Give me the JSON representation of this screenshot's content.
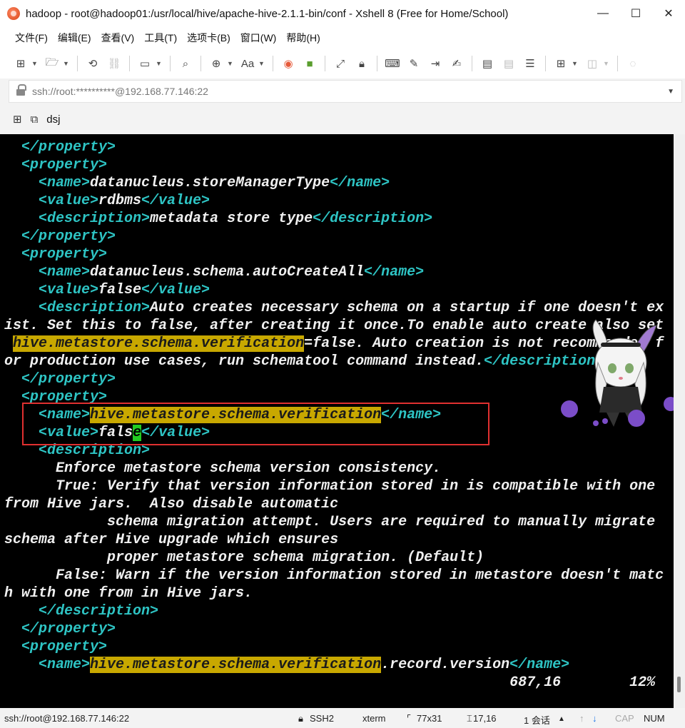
{
  "window": {
    "title": "hadoop - root@hadoop01:/usr/local/hive/apache-hive-2.1.1-bin/conf - Xshell 8 (Free for Home/School)",
    "minimize": "—",
    "maximize": "☐",
    "close": "✕"
  },
  "menu": [
    "文件(F)",
    "编辑(E)",
    "查看(V)",
    "工具(T)",
    "选项卡(B)",
    "窗口(W)",
    "帮助(H)"
  ],
  "address": {
    "text": "ssh://root:**********@192.168.77.146:22",
    "dropdown_icon": "chevron-down-icon"
  },
  "tab": {
    "label": "dsj"
  },
  "terminal": {
    "lines": [
      [
        {
          "t": "  "
        },
        {
          "t": "</property>",
          "c": "tag"
        }
      ],
      [
        {
          "t": "  "
        },
        {
          "t": "<property>",
          "c": "tag"
        }
      ],
      [
        {
          "t": "    "
        },
        {
          "t": "<name>",
          "c": "tag"
        },
        {
          "t": "datanucleus.storeManagerType"
        },
        {
          "t": "</name>",
          "c": "tag"
        }
      ],
      [
        {
          "t": "    "
        },
        {
          "t": "<value>",
          "c": "tag"
        },
        {
          "t": "rdbms"
        },
        {
          "t": "</value>",
          "c": "tag"
        }
      ],
      [
        {
          "t": "    "
        },
        {
          "t": "<description>",
          "c": "tag"
        },
        {
          "t": "metadata store type"
        },
        {
          "t": "</description>",
          "c": "tag"
        }
      ],
      [
        {
          "t": "  "
        },
        {
          "t": "</property>",
          "c": "tag"
        }
      ],
      [
        {
          "t": "  "
        },
        {
          "t": "<property>",
          "c": "tag"
        }
      ],
      [
        {
          "t": "    "
        },
        {
          "t": "<name>",
          "c": "tag"
        },
        {
          "t": "datanucleus.schema.autoCreateAll"
        },
        {
          "t": "</name>",
          "c": "tag"
        }
      ],
      [
        {
          "t": "    "
        },
        {
          "t": "<value>",
          "c": "tag"
        },
        {
          "t": "false"
        },
        {
          "t": "</value>",
          "c": "tag"
        }
      ],
      [
        {
          "t": "    "
        },
        {
          "t": "<description>",
          "c": "tag"
        },
        {
          "t": "Auto creates necessary schema on a startup if one doesn't ex"
        }
      ],
      [
        {
          "t": "ist. Set this to false, after creating it once.To enable auto create also set"
        }
      ],
      [
        {
          "t": " "
        },
        {
          "t": "hive.metastore.schema.verification",
          "c": "hl"
        },
        {
          "t": "=false. Auto creation is not recommended f"
        }
      ],
      [
        {
          "t": "or production use cases, run schematool command instead."
        },
        {
          "t": "</description>",
          "c": "tag"
        }
      ],
      [
        {
          "t": "  "
        },
        {
          "t": "</property>",
          "c": "tag"
        }
      ],
      [
        {
          "t": "  "
        },
        {
          "t": "<property>",
          "c": "tag"
        }
      ],
      [
        {
          "t": "    "
        },
        {
          "t": "<name>",
          "c": "tag"
        },
        {
          "t": "hive.metastore.schema.verification",
          "c": "hl"
        },
        {
          "t": "</name>",
          "c": "tag"
        }
      ],
      [
        {
          "t": "    "
        },
        {
          "t": "<value>",
          "c": "tag"
        },
        {
          "t": "fals"
        },
        {
          "t": "e",
          "c": "cursor"
        },
        {
          "t": "</value>",
          "c": "tag"
        }
      ],
      [
        {
          "t": "    "
        },
        {
          "t": "<description>",
          "c": "tag"
        }
      ],
      [
        {
          "t": "      Enforce metastore schema version consistency."
        }
      ],
      [
        {
          "t": "      True: Verify that version information stored in is compatible with one"
        }
      ],
      [
        {
          "t": "from Hive jars.  Also disable automatic"
        }
      ],
      [
        {
          "t": "            schema migration attempt. Users are required to manually migrate"
        }
      ],
      [
        {
          "t": "schema after Hive upgrade which ensures"
        }
      ],
      [
        {
          "t": "            proper metastore schema migration. (Default)"
        }
      ],
      [
        {
          "t": "      False: Warn if the version information stored in metastore doesn't matc"
        }
      ],
      [
        {
          "t": "h with one from in Hive jars."
        }
      ],
      [
        {
          "t": "    "
        },
        {
          "t": "</description>",
          "c": "tag"
        }
      ],
      [
        {
          "t": "  "
        },
        {
          "t": "</property>",
          "c": "tag"
        }
      ],
      [
        {
          "t": "  "
        },
        {
          "t": "<property>",
          "c": "tag"
        }
      ],
      [
        {
          "t": "    "
        },
        {
          "t": "<name>",
          "c": "tag"
        },
        {
          "t": "hive.metastore.schema.verification",
          "c": "hl"
        },
        {
          "t": ".record.version"
        },
        {
          "t": "</name>",
          "c": "tag"
        }
      ],
      [
        {
          "t": "                                                           687,16        12%"
        }
      ]
    ]
  },
  "statusbar": {
    "connection": "ssh://root@192.168.77.146:22",
    "protocol": "SSH2",
    "terminal_type": "xterm",
    "size": "77x31",
    "cursor_pos": "17,16",
    "sessions": "1 会话",
    "caps": "CAP",
    "num": "NUM"
  },
  "colors": {
    "terminal_bg": "#000000",
    "tag": "#2ec4c4",
    "search_highlight": "#c8a800",
    "cursor": "#22cc22",
    "annotation_box": "#e03030"
  }
}
